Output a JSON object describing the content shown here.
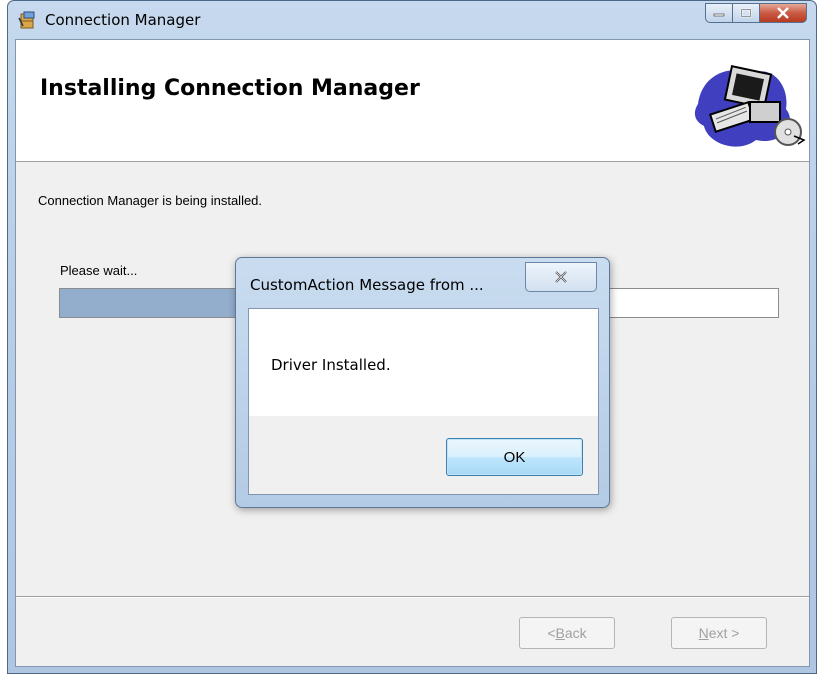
{
  "window": {
    "title": "Connection Manager",
    "caption_buttons": [
      "minimize-icon",
      "maximize-icon",
      "close-icon"
    ]
  },
  "banner": {
    "title": "Installing Connection Manager",
    "art_icon": "computer-setup-icon"
  },
  "body": {
    "status_text": "Connection Manager is being installed.",
    "progress_label": "Please wait...",
    "progress_fraction": 0.35
  },
  "footer": {
    "back_prefix": "< ",
    "back_accel": "B",
    "back_rest": "ack",
    "next_accel": "N",
    "next_rest": "ext >"
  },
  "dialog": {
    "title": "CustomAction Message from ...",
    "message": "Driver Installed.",
    "ok_label": "OK"
  },
  "colors": {
    "progress_fill": "#93adcc",
    "close_button": "#c95a43",
    "ok_border": "#3c7fb1"
  }
}
